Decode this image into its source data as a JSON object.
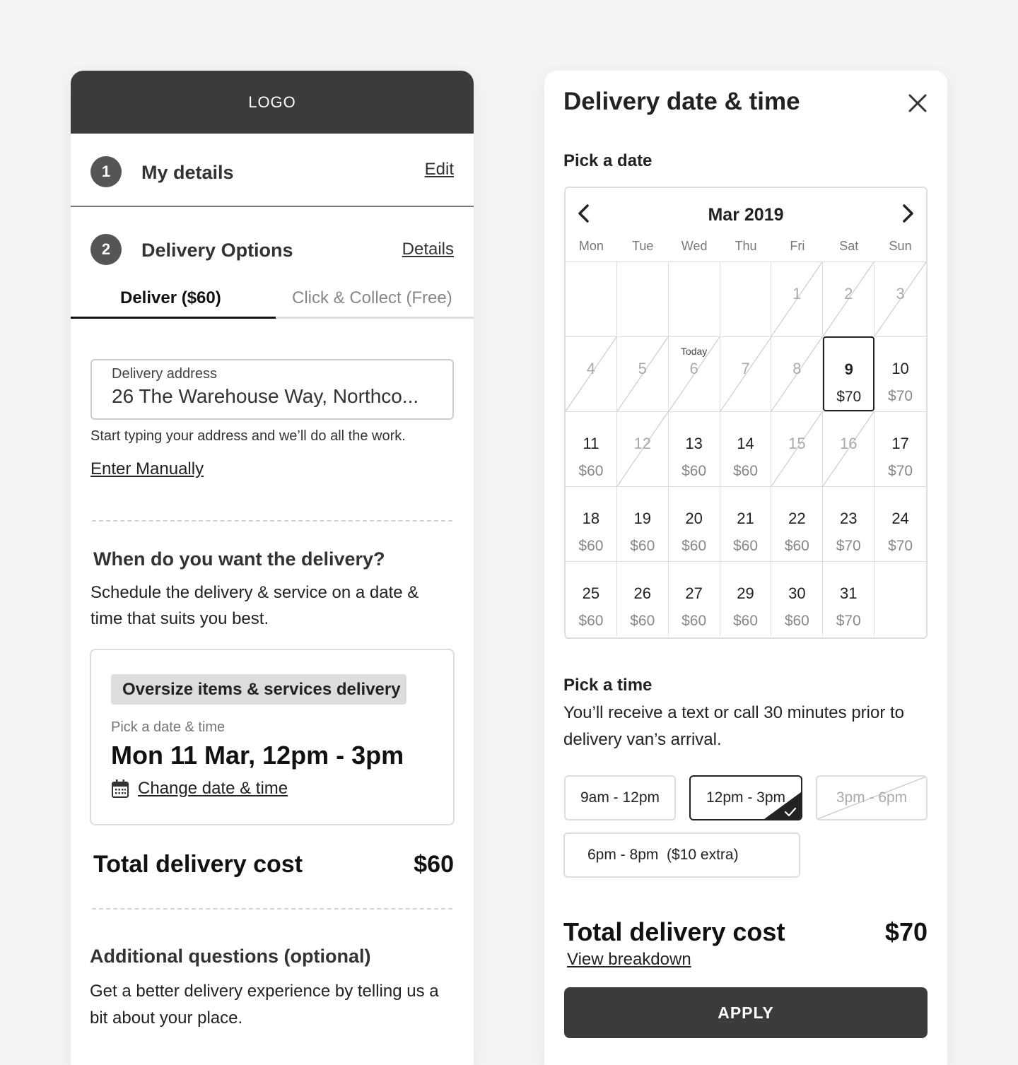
{
  "left": {
    "logo": "LOGO",
    "steps": [
      {
        "number": "1",
        "title": "My details",
        "link": "Edit"
      },
      {
        "number": "2",
        "title": "Delivery Options",
        "link": "Details"
      }
    ],
    "tabs": {
      "deliver": "Deliver ($60)",
      "collect": "Click & Collect (Free)"
    },
    "address": {
      "label": "Delivery address",
      "value": "26 The Warehouse Way, Northco...",
      "hint": "Start typing your address and we’ll do all the work.",
      "enter_manually": "Enter Manually"
    },
    "when": {
      "title": "When do you want the delivery?",
      "description": "Schedule the delivery & service on a date & time that suits you best."
    },
    "selection": {
      "badge": "Oversize items & services delivery",
      "pick_label": "Pick a date & time",
      "value": "Mon 11 Mar, 12pm - 3pm",
      "change_link": "Change date & time",
      "icon": "calendar-icon"
    },
    "total": {
      "label": "Total delivery cost",
      "value": "$60"
    },
    "additional": {
      "title": "Additional questions (optional)",
      "description": "Get a better delivery experience by telling us a bit about your place."
    }
  },
  "right": {
    "title": "Delivery date & time",
    "close_icon": "close-icon",
    "pick_date": "Pick a date",
    "calendar": {
      "month": "Mar 2019",
      "weekdays": [
        "Mon",
        "Tue",
        "Wed",
        "Thu",
        "Fri",
        "Sat",
        "Sun"
      ],
      "days": [
        {
          "num": "",
          "price": "",
          "state": "empty"
        },
        {
          "num": "",
          "price": "",
          "state": "empty"
        },
        {
          "num": "",
          "price": "",
          "state": "empty"
        },
        {
          "num": "",
          "price": "",
          "state": "empty"
        },
        {
          "num": "1",
          "price": "",
          "state": "disabled"
        },
        {
          "num": "2",
          "price": "",
          "state": "disabled"
        },
        {
          "num": "3",
          "price": "",
          "state": "disabled"
        },
        {
          "num": "4",
          "price": "",
          "state": "disabled"
        },
        {
          "num": "5",
          "price": "",
          "state": "disabled"
        },
        {
          "num": "6",
          "price": "",
          "state": "disabled",
          "today": "Today"
        },
        {
          "num": "7",
          "price": "",
          "state": "disabled"
        },
        {
          "num": "8",
          "price": "",
          "state": "disabled"
        },
        {
          "num": "9",
          "price": "$70",
          "state": "selected"
        },
        {
          "num": "10",
          "price": "$70",
          "state": "available"
        },
        {
          "num": "11",
          "price": "$60",
          "state": "available"
        },
        {
          "num": "12",
          "price": "",
          "state": "disabled"
        },
        {
          "num": "13",
          "price": "$60",
          "state": "available"
        },
        {
          "num": "14",
          "price": "$60",
          "state": "available"
        },
        {
          "num": "15",
          "price": "",
          "state": "disabled"
        },
        {
          "num": "16",
          "price": "",
          "state": "disabled"
        },
        {
          "num": "17",
          "price": "$70",
          "state": "available"
        },
        {
          "num": "18",
          "price": "$60",
          "state": "available"
        },
        {
          "num": "19",
          "price": "$60",
          "state": "available"
        },
        {
          "num": "20",
          "price": "$60",
          "state": "available"
        },
        {
          "num": "21",
          "price": "$60",
          "state": "available"
        },
        {
          "num": "22",
          "price": "$60",
          "state": "available"
        },
        {
          "num": "23",
          "price": "$70",
          "state": "available"
        },
        {
          "num": "24",
          "price": "$70",
          "state": "available"
        },
        {
          "num": "25",
          "price": "$60",
          "state": "available"
        },
        {
          "num": "26",
          "price": "$60",
          "state": "available"
        },
        {
          "num": "27",
          "price": "$60",
          "state": "available"
        },
        {
          "num": "29",
          "price": "$60",
          "state": "available"
        },
        {
          "num": "30",
          "price": "$60",
          "state": "available"
        },
        {
          "num": "31",
          "price": "$70",
          "state": "available"
        },
        {
          "num": "",
          "price": "",
          "state": "empty"
        }
      ]
    },
    "pick_time": "Pick a time",
    "time_description": "You’ll receive a text or call 30 minutes prior to delivery van’s arrival.",
    "slots": [
      {
        "label": "9am - 12pm",
        "state": "available"
      },
      {
        "label": "12pm - 3pm",
        "state": "selected"
      },
      {
        "label": "3pm - 6pm",
        "state": "disabled"
      },
      {
        "label": "6pm - 8pm  ($10 extra)",
        "state": "available"
      }
    ],
    "total": {
      "label": "Total delivery cost",
      "value": "$70"
    },
    "view_breakdown": "View breakdown",
    "apply": "APPLY"
  }
}
